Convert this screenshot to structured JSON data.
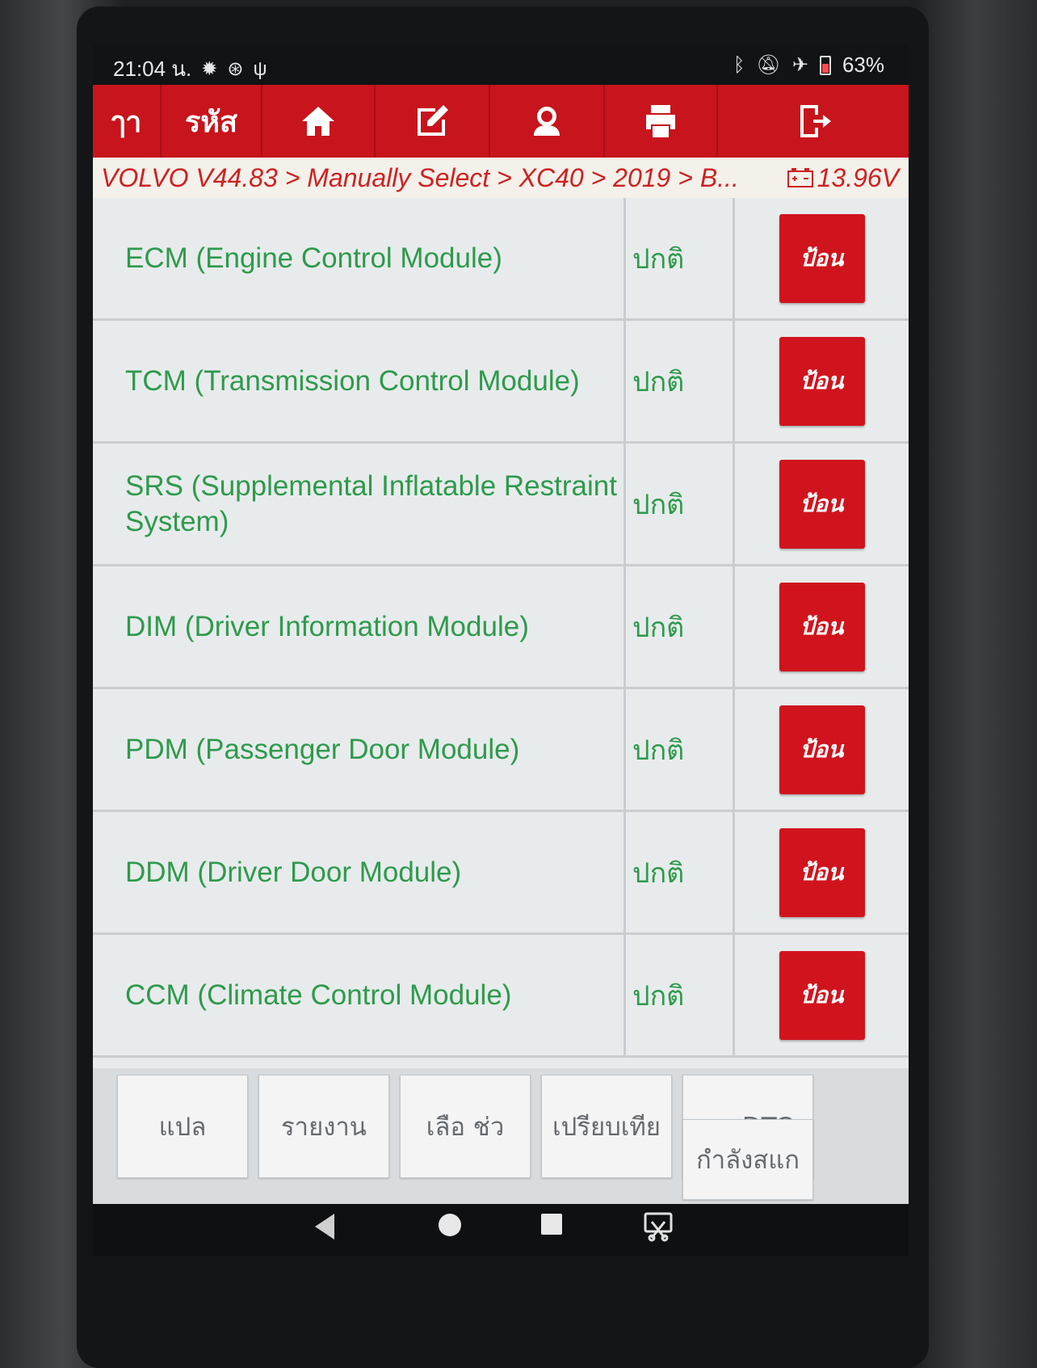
{
  "status_bar": {
    "time": "21:04 น.",
    "battery_percent": "63%",
    "left_icons": [
      "gear-icon",
      "android-debug-icon",
      "stethoscope-icon"
    ],
    "right_icons": [
      "bluetooth-icon",
      "muted-bell-icon",
      "airplane-icon",
      "battery-icon"
    ]
  },
  "toolbar": {
    "back_label": "ๅา",
    "code_label": "รหัส",
    "icons": [
      "home-icon",
      "edit-icon",
      "user-support-icon",
      "print-icon",
      "exit-icon"
    ]
  },
  "breadcrumb": {
    "path": "VOLVO V44.83 > Manually Select > XC40 > 2019 > B...",
    "voltage": "13.96V"
  },
  "modules": [
    {
      "name": "ECM (Engine Control Module)",
      "status": "ปกติ",
      "action": "ป้อน"
    },
    {
      "name": "TCM (Transmission Control Module)",
      "status": "ปกติ",
      "action": "ป้อน"
    },
    {
      "name": "SRS (Supplemental Inflatable Restraint System)",
      "status": "ปกติ",
      "action": "ป้อน"
    },
    {
      "name": "DIM (Driver Information Module)",
      "status": "ปกติ",
      "action": "ป้อน"
    },
    {
      "name": "PDM (Passenger Door Module)",
      "status": "ปกติ",
      "action": "ป้อน"
    },
    {
      "name": "DDM (Driver Door Module)",
      "status": "ปกติ",
      "action": "ป้อน"
    },
    {
      "name": "CCM (Climate Control Module)",
      "status": "ปกติ",
      "action": "ป้อน"
    }
  ],
  "actions": {
    "translate": "แปล",
    "report": "รายงาน",
    "select": "เลือ ช่ว",
    "compare": "เปรียบเทีย",
    "clear_dtc": "ลบ DTC",
    "scanning": "กำลังสแก"
  },
  "colors": {
    "toolbar_red": "#c8141c",
    "enter_button_red": "#d0141e",
    "module_text_green": "#2e9a4c",
    "breadcrumb_red": "#cc2222"
  }
}
